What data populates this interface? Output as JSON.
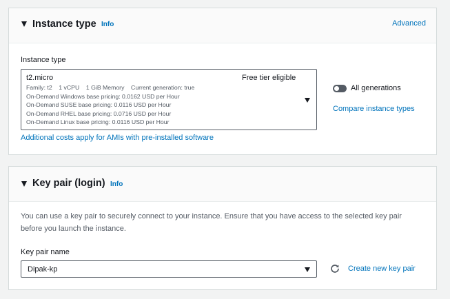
{
  "instance_type_panel": {
    "title": "Instance type",
    "info": "Info",
    "advanced": "Advanced",
    "field_label": "Instance type",
    "selected": {
      "name": "t2.micro",
      "badge": "Free tier eligible",
      "specs": "Family: t2    1 vCPU    1 GiB Memory    Current generation: true",
      "pricing": [
        "On-Demand Windows base pricing: 0.0162 USD per Hour",
        "On-Demand SUSE base pricing: 0.0116 USD per Hour",
        "On-Demand RHEL base pricing: 0.0716 USD per Hour",
        "On-Demand Linux base pricing: 0.0116 USD per Hour"
      ]
    },
    "toggle_label": "All generations",
    "toggle_on": false,
    "compare_link": "Compare instance types",
    "costs_link": "Additional costs apply for AMIs with pre-installed software"
  },
  "key_pair_panel": {
    "title": "Key pair (login)",
    "info": "Info",
    "description_line1": "You can use a key pair to securely connect to your instance. Ensure that you have access to the selected key pair",
    "description_line2": "before you launch the instance.",
    "field_label": "Key pair name",
    "selected": "Dipak-kp",
    "create_link": "Create new key pair"
  },
  "colors": {
    "link": "#0073bb",
    "text": "#16191f",
    "muted": "#545b64",
    "border": "#d5dbdb"
  }
}
